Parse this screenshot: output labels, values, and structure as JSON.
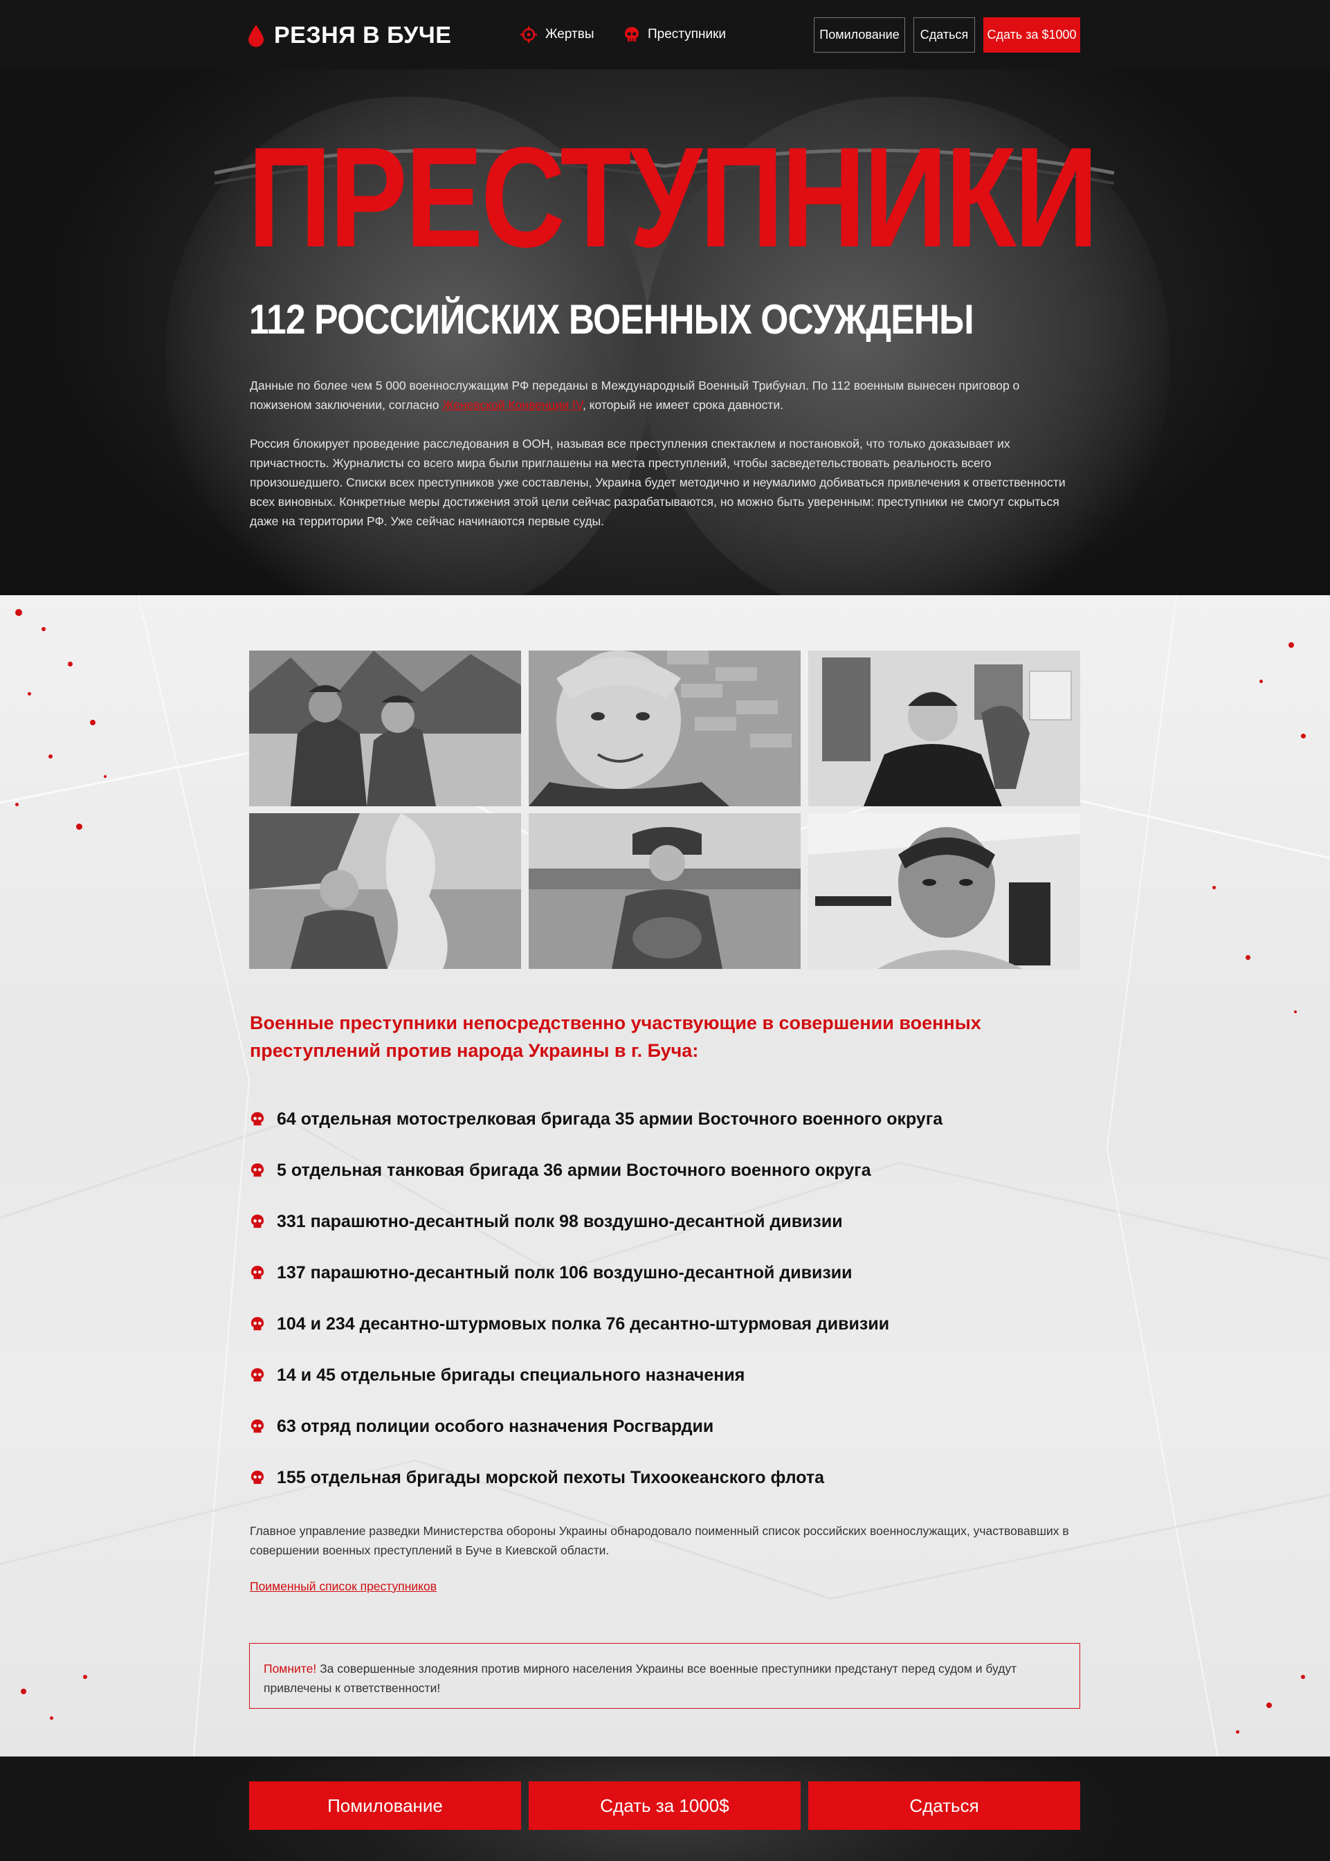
{
  "colors": {
    "accent": "#e00d12",
    "dark": "#151515"
  },
  "nav": {
    "logo": "РЕЗНЯ В БУЧЕ",
    "links": [
      "Жертвы",
      "Преступники"
    ],
    "buttons": [
      "Помилование",
      "Сдаться",
      "Сдать за $1000"
    ]
  },
  "hero": {
    "title": "ПРЕСТУПНИКИ",
    "subtitle": "112 РОССИЙСКИХ ВОЕННЫХ ОСУЖДЕНЫ",
    "p1_before": "Данные по более чем 5 000 военнослужащим РФ переданы в Международный Военный Трибунал. По 112 военным  вынесен приговор о пожизеном заключении, согласно ",
    "p1_link": "Женевской Конвенции IV",
    "p1_after": ", который не имеет срока давности.",
    "p2": "Россия блокирует проведение расследования в ООН, называя все преступления спектаклем и постановкой, что только доказывает их причастность. Журналисты со всего мира были приглашены на места преступлений, чтобы засведетельствовать реальность всего произошедшего. Списки всех преступников уже составлены, Украина будет методично и неумалимо добиваться привлечения к ответственности всех виновных. Конкретные меры достижения этой цели сейчас разрабатываются, но можно быть уверенным: преступники не смогут скрыться даже на территории РФ. Уже сейчас начинаются первые суды."
  },
  "content": {
    "lead": "Военные преступники непосредственно участвующие в совершении военных преступлений против народа Украины в г. Буча:",
    "units": [
      "64 отдельная мотострелковая бригада 35 армии Восточного военного округа",
      "5 отдельная танковая бригада 36 армии Восточного военного округа",
      "331 парашютно-десантный полк 98 воздушно-десантной дивизии",
      "137 парашютно-десантный полк 106 воздушно-десантной дивизии",
      "104 и 234 десантно-штурмовых полка 76 десантно-штурмовая дивизии",
      "14 и 45 отдельные бригады специального назначения",
      "63 отряд полиции особого назначения Росгвардии",
      "155 отдельная бригады морской пехоты Тихоокеанского флота"
    ],
    "info": "Главное управление разведки Министерства обороны Украины обнародовало поименный список российских военнослужащих, участвовавших в совершении военных преступлений в Буче в Киевской области.",
    "list_link": "Поименный список преступников",
    "notice_key": "Помните!",
    "notice_text": " За совершенные злодеяния против мирного населения Украины все военные преступники предстанут перед судом и будут привлечены к ответственности!"
  },
  "footer": {
    "buttons": [
      "Помилование",
      "Сдать за 1000$",
      "Сдаться"
    ]
  }
}
